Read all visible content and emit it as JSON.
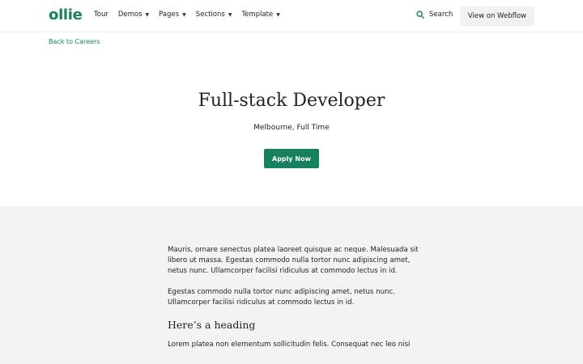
{
  "header": {
    "logo": "ollie",
    "nav": [
      {
        "label": "Tour",
        "dropdown": false
      },
      {
        "label": "Demos",
        "dropdown": true
      },
      {
        "label": "Pages",
        "dropdown": true
      },
      {
        "label": "Sections",
        "dropdown": true
      },
      {
        "label": "Template",
        "dropdown": true
      }
    ],
    "search_label": "Search",
    "webflow_button": "View on Webflow"
  },
  "back_link": "Back to Careers",
  "hero": {
    "title": "Full-stack Developer",
    "subtitle": "Melbourne, Full Time",
    "apply_button": "Apply Now"
  },
  "content": {
    "paragraph_1": "Mauris, ornare senectus platea laoreet quisque ac neque. Malesuada sit libero ut massa. Egestas commodo nulla tortor nunc adipiscing amet, netus nunc. Ullamcorper facilisi ridiculus at commodo lectus in id.",
    "paragraph_2": "Egestas commodo nulla tortor nunc adipiscing amet, netus nunc. Ullamcorper facilisi ridiculus at commodo lectus in id.",
    "heading": "Here’s a heading",
    "paragraph_3": "Lorem platea non elementum sollicitudin felis. Consequat nec leo nisi"
  },
  "colors": {
    "brand": "#16805f",
    "band_background": "#f4f3f1",
    "secondary_button": "#f1f1f1"
  },
  "icons": {
    "search": "search-icon",
    "caret": "caret-down-icon"
  }
}
